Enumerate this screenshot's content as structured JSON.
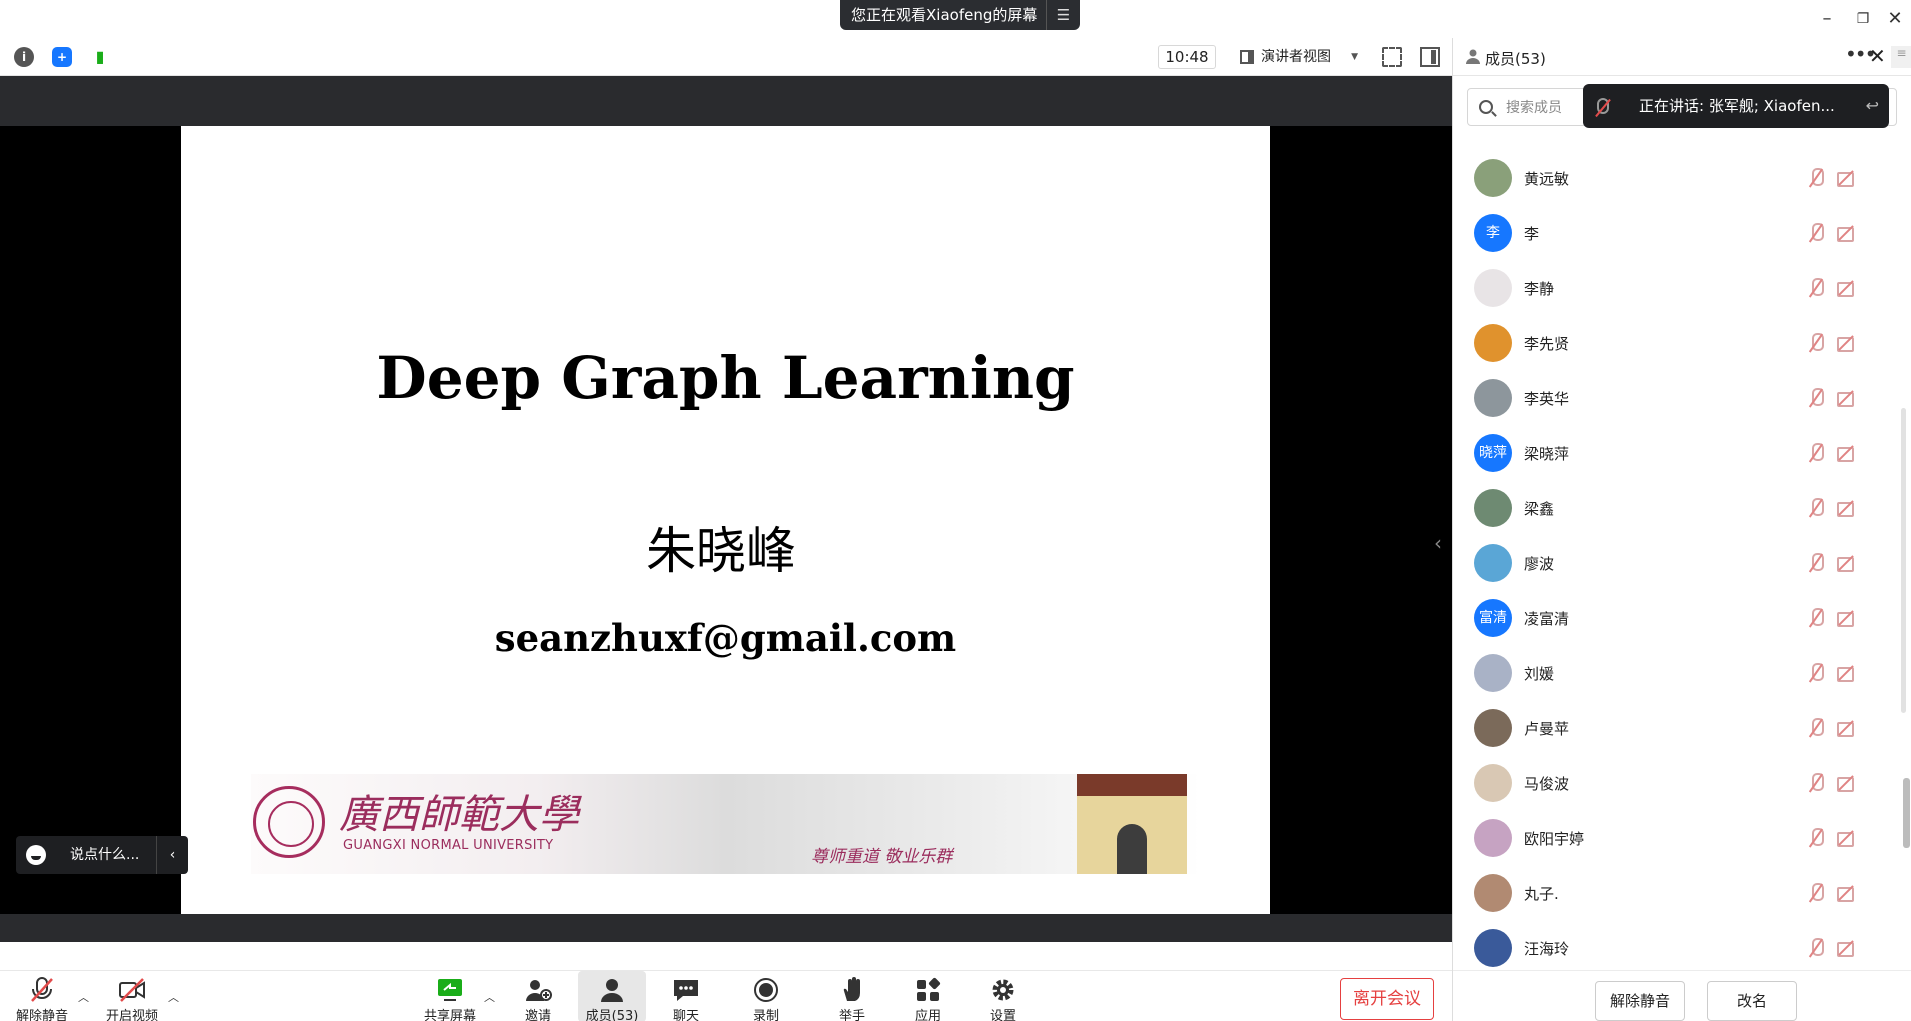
{
  "banner": {
    "viewing_text": "您正在观看Xiaofeng的屏幕"
  },
  "toolbar": {
    "clock": "10:48",
    "view_mode": "演讲者视图"
  },
  "slide": {
    "title": "Deep Graph Learning",
    "author": "朱晓峰",
    "email": "seanzhuxf@gmail.com",
    "logo_cn": "廣西師範大學",
    "logo_en": "GUANGXI NORMAL UNIVERSITY",
    "motto": "尊师重道 敬业乐群"
  },
  "chat": {
    "placeholder": "说点什么..."
  },
  "bottombar": {
    "unmute": "解除静音",
    "start_video": "开启视频",
    "share_screen": "共享屏幕",
    "invite": "邀请",
    "members": "成员(53)",
    "chat": "聊天",
    "record": "录制",
    "raise_hand": "举手",
    "apps": "应用",
    "settings": "设置",
    "leave": "离开会议"
  },
  "panel": {
    "title": "成员(53)",
    "search_placeholder": "搜索成员",
    "speaking": "正在讲话: 张军舰; Xiaofen...",
    "members": [
      {
        "name": "黄远敏",
        "avatar_text": "",
        "color": "#8aa07a"
      },
      {
        "name": "李",
        "avatar_text": "李",
        "color": "#1677ff"
      },
      {
        "name": "李静",
        "avatar_text": "",
        "color": "#e8e4e6"
      },
      {
        "name": "李先贤",
        "avatar_text": "",
        "color": "#e0922d"
      },
      {
        "name": "李英华",
        "avatar_text": "",
        "color": "#8d969c"
      },
      {
        "name": "梁晓萍",
        "avatar_text": "晓萍",
        "color": "#1677ff"
      },
      {
        "name": "梁鑫",
        "avatar_text": "",
        "color": "#6e8a72"
      },
      {
        "name": "廖波",
        "avatar_text": "",
        "color": "#5aa6d6"
      },
      {
        "name": "凌富清",
        "avatar_text": "富清",
        "color": "#1677ff"
      },
      {
        "name": "刘媛",
        "avatar_text": "",
        "color": "#a9b2c6"
      },
      {
        "name": "卢曼苹",
        "avatar_text": "",
        "color": "#7b6a5a"
      },
      {
        "name": "马俊波",
        "avatar_text": "",
        "color": "#d9c8b4"
      },
      {
        "name": "欧阳宇婷",
        "avatar_text": "",
        "color": "#c6a3c2"
      },
      {
        "name": "丸子.",
        "avatar_text": "",
        "color": "#b18a72"
      },
      {
        "name": "汪海玲",
        "avatar_text": "",
        "color": "#3a5a9a"
      }
    ],
    "unmute_all": "解除静音",
    "rename": "改名"
  }
}
